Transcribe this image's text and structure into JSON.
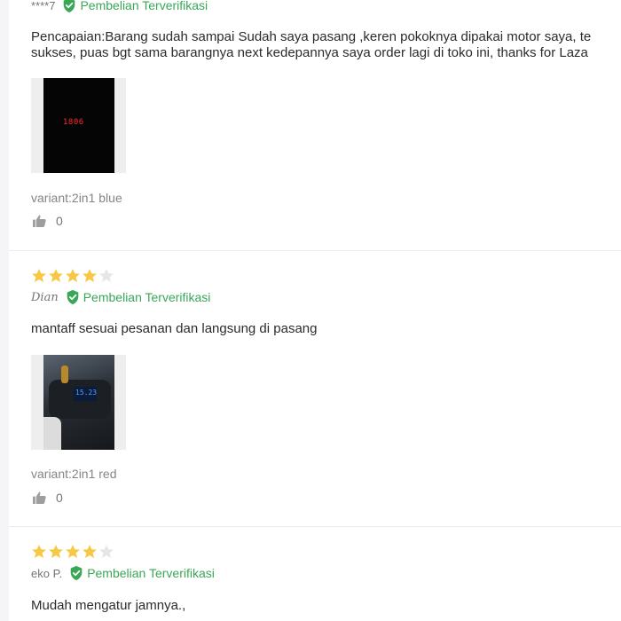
{
  "badge_label": "Pembelian Terverifikasi",
  "colors": {
    "star_on": "#f7c843",
    "star_off": "#e6e6e6",
    "verified": "#3aa757"
  },
  "reviews": [
    {
      "author": "****7",
      "text_line1": "Pencapaian:Barang sudah sampai Sudah saya pasang ,keren pokoknya dipakai motor saya, te",
      "text_line2": "sukses, puas bgt sama barangnya next kedepannya saya order lagi di toko ini, thanks for Laza",
      "photo_display": "1806",
      "variant": "variant:2in1 blue",
      "likes": "0"
    },
    {
      "rating": 4,
      "author": "Dian",
      "text": "mantaff sesuai pesanan dan langsung di pasang",
      "photo_display": "15.23",
      "variant": "variant:2in1 red",
      "likes": "0"
    },
    {
      "rating": 4,
      "author": "eko P.",
      "text": "Mudah mengatur jamnya.,"
    }
  ]
}
